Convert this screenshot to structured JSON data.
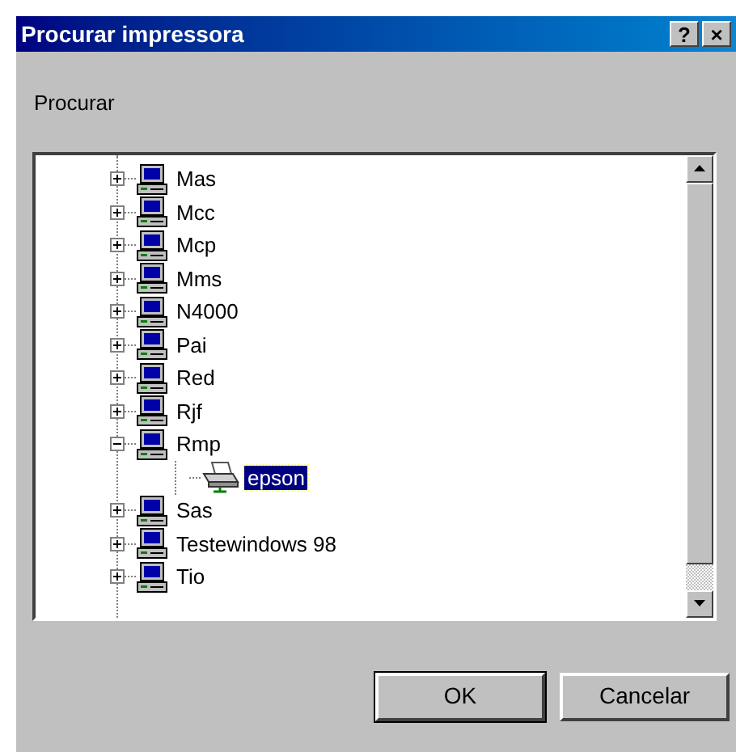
{
  "window": {
    "title": "Procurar impressora",
    "title_buttons": [
      "?",
      "×"
    ]
  },
  "label": "Procurar",
  "tree": [
    {
      "kind": "computer",
      "label": "Mas",
      "expanded": false,
      "selected": false
    },
    {
      "kind": "computer",
      "label": "Mcc",
      "expanded": false,
      "selected": false
    },
    {
      "kind": "computer",
      "label": "Mcp",
      "expanded": false,
      "selected": false
    },
    {
      "kind": "computer",
      "label": "Mms",
      "expanded": false,
      "selected": false
    },
    {
      "kind": "computer",
      "label": "N4000",
      "expanded": false,
      "selected": false
    },
    {
      "kind": "computer",
      "label": "Pai",
      "expanded": false,
      "selected": false
    },
    {
      "kind": "computer",
      "label": "Red",
      "expanded": false,
      "selected": false
    },
    {
      "kind": "computer",
      "label": "Rjf",
      "expanded": false,
      "selected": false
    },
    {
      "kind": "computer",
      "label": "Rmp",
      "expanded": true,
      "selected": false,
      "children": [
        {
          "kind": "printer",
          "label": "epson",
          "selected": true
        }
      ]
    },
    {
      "kind": "computer",
      "label": "Sas",
      "expanded": false,
      "selected": false
    },
    {
      "kind": "computer",
      "label": "Testewindows 98",
      "expanded": false,
      "selected": false
    },
    {
      "kind": "computer",
      "label": "Tio",
      "expanded": false,
      "selected": false
    }
  ],
  "buttons": [
    {
      "label": "OK",
      "default": true
    },
    {
      "label": "Cancelar",
      "default": false
    }
  ]
}
